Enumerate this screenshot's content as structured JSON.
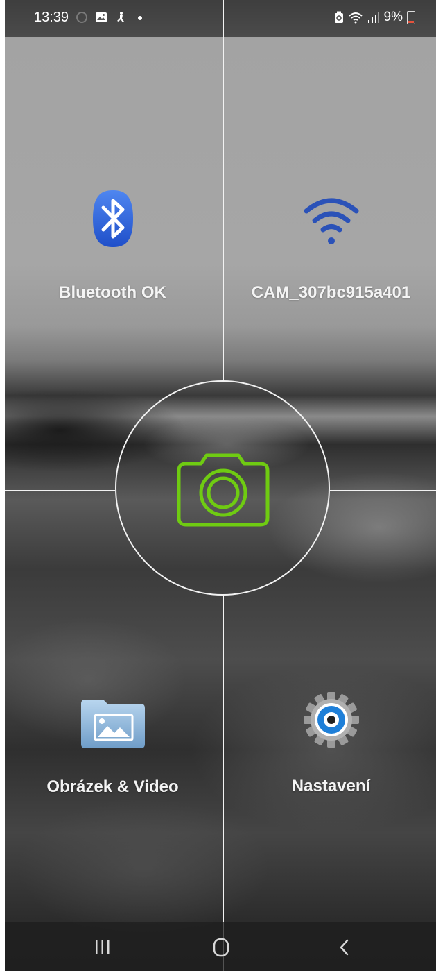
{
  "status_bar": {
    "time": "13:39",
    "battery_percent": "9%",
    "icons": [
      "alarm-icon",
      "image-icon",
      "accessibility-icon",
      "notification-dot-icon",
      "battery-saver-icon",
      "wifi-icon",
      "signal-icon",
      "battery-icon"
    ]
  },
  "tiles": {
    "bluetooth": {
      "label": "Bluetooth OK",
      "icon": "bluetooth-icon"
    },
    "wifi": {
      "label": "CAM_307bc915a401",
      "icon": "wifi-icon"
    },
    "gallery": {
      "label": "Obrázek & Video",
      "icon": "image-folder-icon"
    },
    "settings": {
      "label": "Nastavení",
      "icon": "gear-icon"
    }
  },
  "center_button": {
    "icon": "camera-icon",
    "color": "#6fcb12"
  },
  "nav_bar": {
    "buttons": [
      "recent-apps-icon",
      "home-icon",
      "back-icon"
    ]
  },
  "colors": {
    "bluetooth": "#2a5fd6",
    "wifi": "#2b52b8",
    "camera": "#6fcb12"
  }
}
